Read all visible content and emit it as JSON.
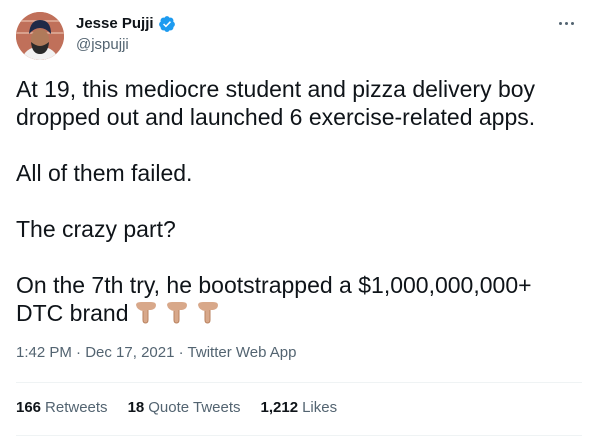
{
  "author": {
    "name": "Jesse Pujji",
    "handle": "@jspujji",
    "verified_color": "#1d9bf0"
  },
  "tweet": {
    "line1": "At 19, this mediocre student and pizza delivery boy",
    "line2": "dropped out and launched 6 exercise-related apps.",
    "line3": "All of them failed.",
    "line4": "The crazy part?",
    "line5": "On the 7th try, he bootstrapped a $1,000,000,000+",
    "line6": "DTC brand",
    "emoji": [
      "backhand-index-pointing-down",
      "backhand-index-pointing-down",
      "backhand-index-pointing-down"
    ]
  },
  "meta": {
    "time": "1:42 PM",
    "sep1": "·",
    "date": "Dec 17, 2021",
    "sep2": "·",
    "client": "Twitter Web App"
  },
  "stats": {
    "retweets_count": "166",
    "retweets_label": "Retweets",
    "quotes_count": "18",
    "quotes_label": "Quote Tweets",
    "likes_count": "1,212",
    "likes_label": "Likes"
  }
}
